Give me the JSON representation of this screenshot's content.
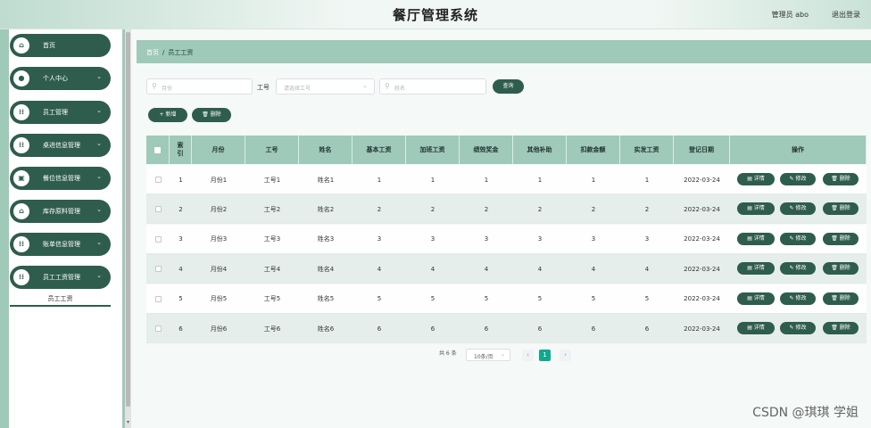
{
  "header": {
    "title": "餐厅管理系统",
    "admin": "管理员 abo",
    "logout": "退出登录"
  },
  "sidebar": {
    "items": [
      {
        "label": "首页",
        "icon": "home-icon",
        "glyph": "⌂",
        "chevron": ""
      },
      {
        "label": "个人中心",
        "icon": "user-icon",
        "glyph": "●",
        "chevron": "⌄"
      },
      {
        "label": "员工管理",
        "icon": "grid-icon",
        "glyph": "⁞⁞",
        "chevron": "⌄"
      },
      {
        "label": "桌进信息管理",
        "icon": "grid-icon",
        "glyph": "⁞⁞",
        "chevron": "⌄"
      },
      {
        "label": "餐位信息管理",
        "icon": "doc-icon",
        "glyph": "▣",
        "chevron": "⌄"
      },
      {
        "label": "库存原料管理",
        "icon": "bank-icon",
        "glyph": "⌂",
        "chevron": "⌄"
      },
      {
        "label": "账单信息管理",
        "icon": "grid-icon",
        "glyph": "⁞⁞",
        "chevron": "⌄"
      },
      {
        "label": "员工工资管理",
        "icon": "grid-icon",
        "glyph": "⁞⁞",
        "chevron": "⌄"
      }
    ],
    "sub_item": "员工工资"
  },
  "breadcrumb": {
    "home": "首页",
    "sep": "/",
    "current": "员工工资"
  },
  "search": {
    "month_placeholder": "月份",
    "id_label": "工号",
    "id_placeholder": "请选择工号",
    "name_placeholder": "姓名",
    "query_button": "查询"
  },
  "actions": {
    "add": "+ 新增",
    "delete": "🗑 删除"
  },
  "table": {
    "headers": [
      "索引",
      "月份",
      "工号",
      "姓名",
      "基本工资",
      "加班工资",
      "绩效奖金",
      "其他补助",
      "扣款金额",
      "实发工资",
      "登记日期",
      "操作"
    ],
    "rows": [
      [
        "1",
        "月份1",
        "工号1",
        "姓名1",
        "1",
        "1",
        "1",
        "1",
        "1",
        "1",
        "2022-03-24"
      ],
      [
        "2",
        "月份2",
        "工号2",
        "姓名2",
        "2",
        "2",
        "2",
        "2",
        "2",
        "2",
        "2022-03-24"
      ],
      [
        "3",
        "月份3",
        "工号3",
        "姓名3",
        "3",
        "3",
        "3",
        "3",
        "3",
        "3",
        "2022-03-24"
      ],
      [
        "4",
        "月份4",
        "工号4",
        "姓名4",
        "4",
        "4",
        "4",
        "4",
        "4",
        "4",
        "2022-03-24"
      ],
      [
        "5",
        "月份5",
        "工号5",
        "姓名5",
        "5",
        "5",
        "5",
        "5",
        "5",
        "5",
        "2022-03-24"
      ],
      [
        "6",
        "月份6",
        "工号6",
        "姓名6",
        "6",
        "6",
        "6",
        "6",
        "6",
        "6",
        "2022-03-24"
      ]
    ],
    "row_buttons": {
      "detail": "详情",
      "edit": "修改",
      "delete": "删除"
    }
  },
  "pagination": {
    "total": "共 6 条",
    "page_size": "10条/页",
    "current_page": "1",
    "prev": "‹",
    "next": "›"
  },
  "watermark": "CSDN @琪琪 学姐",
  "colors": {
    "primary": "#2f5d4d",
    "accent_light": "#9fc9b9",
    "page_current": "#11a88f"
  }
}
